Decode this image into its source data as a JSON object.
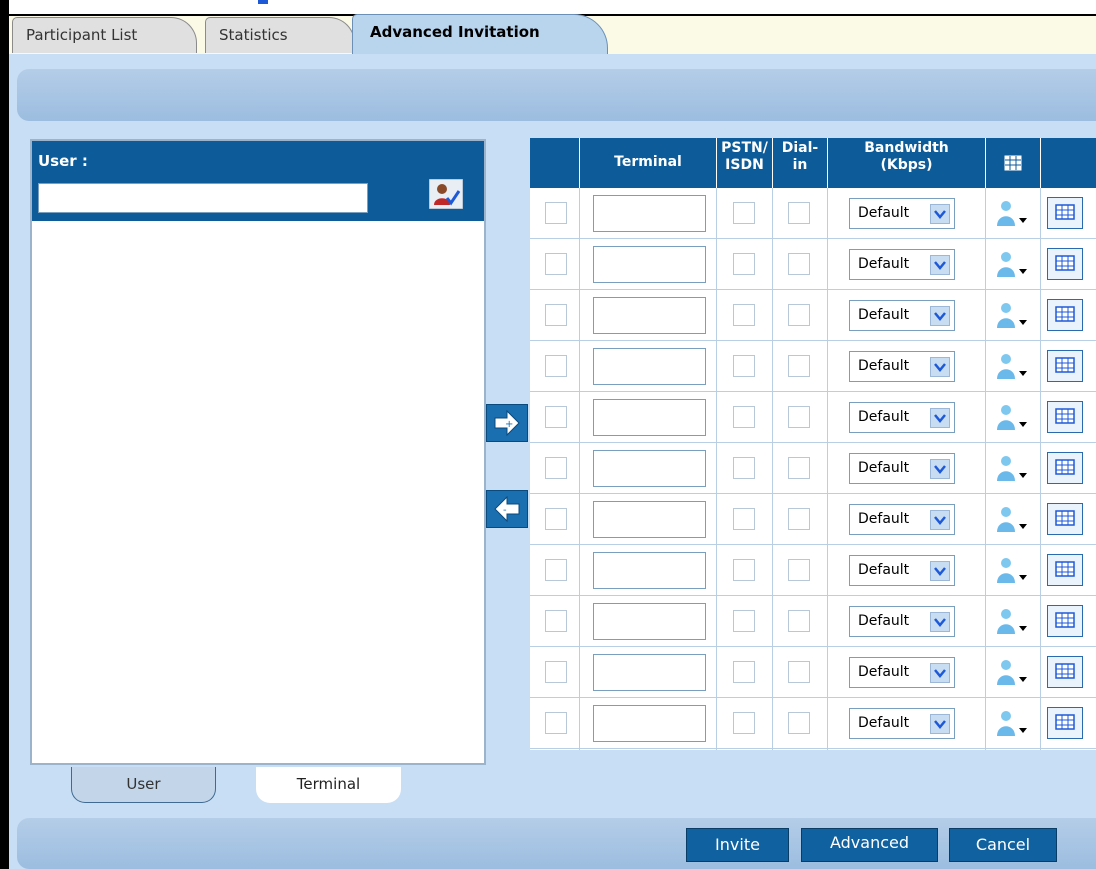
{
  "tabs": [
    {
      "label": "Participant List",
      "active": false
    },
    {
      "label": "Statistics",
      "active": false
    },
    {
      "label": "Advanced Invitation",
      "active": true
    }
  ],
  "left_panel": {
    "user_label": "User :",
    "user_input_value": "",
    "view_tabs": {
      "user": "User",
      "terminal": "Terminal"
    }
  },
  "grid": {
    "headers": {
      "terminal": "Terminal",
      "pstn": "PSTN/\nISDN",
      "dialin": "Dial-\nin",
      "bandwidth": "Bandwidth\n(Kbps)"
    },
    "rows": [
      {
        "bandwidth": "Default"
      },
      {
        "bandwidth": "Default"
      },
      {
        "bandwidth": "Default"
      },
      {
        "bandwidth": "Default"
      },
      {
        "bandwidth": "Default"
      },
      {
        "bandwidth": "Default"
      },
      {
        "bandwidth": "Default"
      },
      {
        "bandwidth": "Default"
      },
      {
        "bandwidth": "Default"
      },
      {
        "bandwidth": "Default"
      },
      {
        "bandwidth": "Default"
      }
    ]
  },
  "buttons": {
    "invite": "Invite",
    "advanced": "Advanced",
    "cancel": "Cancel"
  },
  "colors": {
    "header_blue": "#0d5c99",
    "panel_bg": "#c8def5",
    "button_blue": "#1061a0"
  },
  "icons": [
    "user-search-icon",
    "add-arrow-icon",
    "remove-arrow-icon",
    "person-dropdown-icon",
    "grid-table-icon",
    "dropdown-arrow-icon"
  ]
}
